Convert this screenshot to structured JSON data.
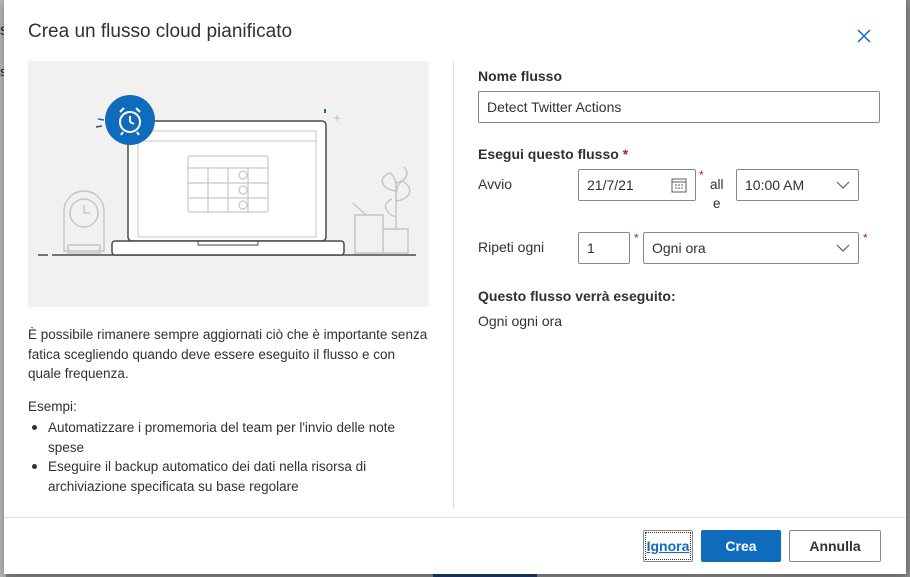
{
  "background": {
    "left_glyph_1": "s",
    "left_glyph_2": "s"
  },
  "dialog": {
    "title": "Crea un flusso cloud pianificato",
    "description": "È possibile rimanere sempre aggiornati ciò che è importante senza fatica scegliendo quando deve essere eseguito il flusso e con quale frequenza.",
    "examples_label": "Esempi:",
    "examples": [
      "Automatizzare i promemoria del team per l'invio delle note spese",
      "Eseguire il backup automatico dei dati nella risorsa di archiviazione specificata su base regolare"
    ],
    "icons": {
      "close": "close-icon",
      "clock": "alarm-clock-icon",
      "calendar": "calendar-icon",
      "chevron": "chevron-down-icon"
    },
    "colors": {
      "accent": "#0f6cbd",
      "required": "#a4262c",
      "illustration_bg": "#f2f1f0"
    }
  },
  "form": {
    "flow_name_label": "Nome flusso",
    "flow_name_value": "Detect Twitter Actions",
    "run_label": "Esegui questo flusso",
    "required_mark": "*",
    "start_label": "Avvio",
    "start_date": "21/7/21",
    "at_label_1": "all",
    "at_label_2": "e",
    "start_time": "10:00 AM",
    "repeat_label": "Ripeti ogni",
    "repeat_value": "1",
    "repeat_unit": "Ogni ora",
    "summary_label": "Questo flusso verrà eseguito:",
    "summary_value": "Ogni ogni ora"
  },
  "footer": {
    "ignore_label": "Ignora",
    "create_label": "Crea",
    "cancel_label": "Annulla"
  }
}
